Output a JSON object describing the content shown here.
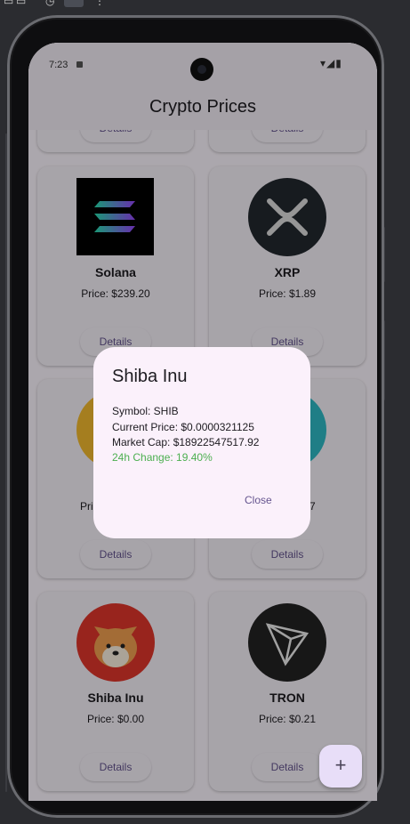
{
  "status_bar": {
    "time": "7:23"
  },
  "app_bar": {
    "title": "Crypto Prices"
  },
  "cards": [
    {
      "name": "",
      "price": "",
      "details": "Details"
    },
    {
      "name": "",
      "price": "",
      "details": "Details"
    },
    {
      "name": "Solana",
      "price": "Price: $239.20",
      "details": "Details",
      "icon": "solana-logo-icon"
    },
    {
      "name": "XRP",
      "price": "Price: $1.89",
      "details": "Details",
      "icon": "xrp-logo-icon"
    },
    {
      "name": "",
      "price": "Pri",
      "details": "Details",
      "icon": "coin-logo-icon"
    },
    {
      "name": "",
      "price": "7",
      "details": "Details",
      "icon": "coin-logo-icon"
    },
    {
      "name": "Shiba Inu",
      "price": "Price: $0.00",
      "details": "Details",
      "icon": "shiba-inu-logo-icon"
    },
    {
      "name": "TRON",
      "price": "Price: $0.21",
      "details": "Details",
      "icon": "tron-logo-icon"
    }
  ],
  "dialog": {
    "title": "Shiba Inu",
    "symbol": "Symbol: SHIB",
    "current_price": "Current Price: $0.0000321125",
    "market_cap": "Market Cap: $18922547517.92",
    "change": "24h Change: 19.40%",
    "close_label": "Close"
  },
  "fab": {
    "label": "+"
  },
  "colors": {
    "accent": "#65558f",
    "positive": "#4caf50",
    "surface": "#fdf7ff",
    "dialog_bg": "#fbf1fb"
  }
}
